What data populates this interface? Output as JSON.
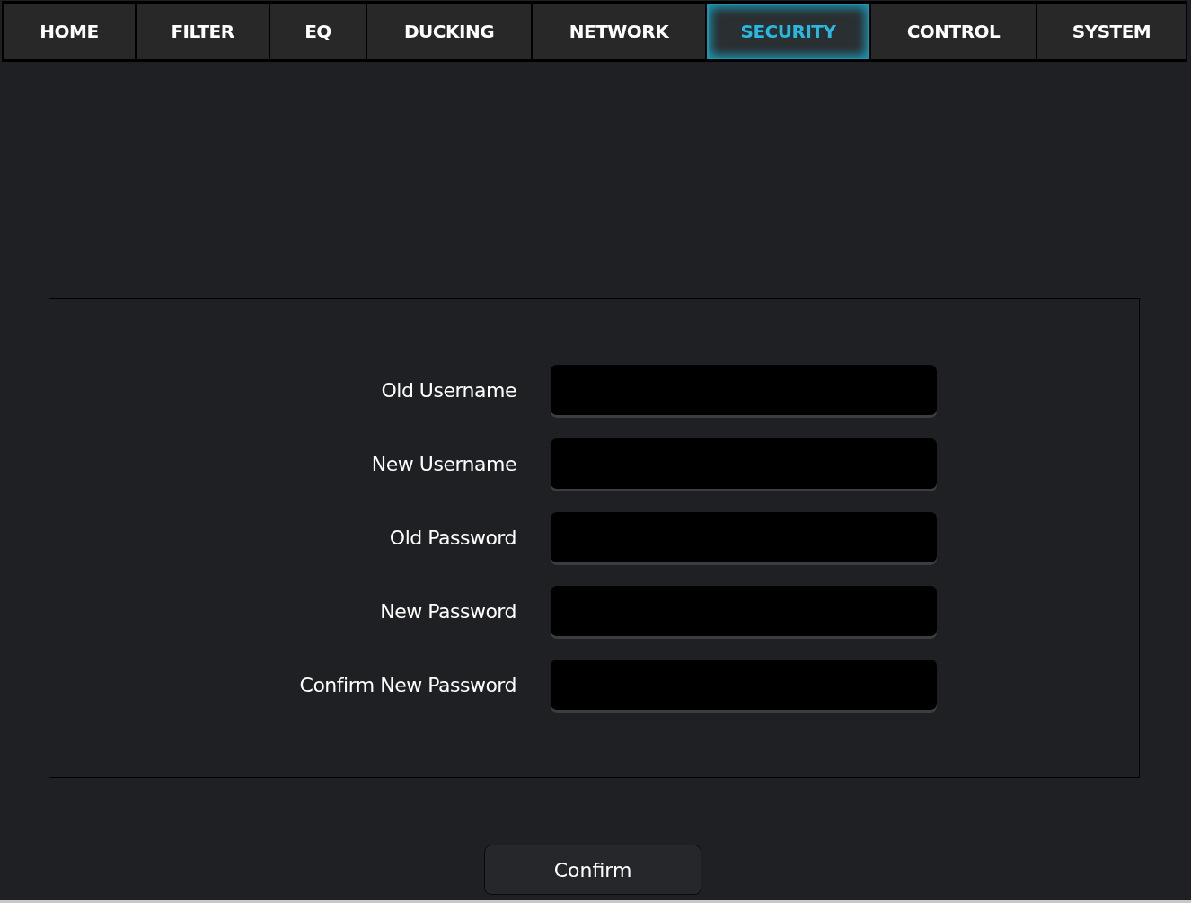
{
  "tabs": [
    {
      "label": "HOME",
      "selected": false
    },
    {
      "label": "FILTER",
      "selected": false
    },
    {
      "label": "EQ",
      "selected": false
    },
    {
      "label": "DUCKING",
      "selected": false
    },
    {
      "label": "NETWORK",
      "selected": false
    },
    {
      "label": "SECURITY",
      "selected": true
    },
    {
      "label": "CONTROL",
      "selected": false
    },
    {
      "label": "SYSTEM",
      "selected": false
    }
  ],
  "form": {
    "fields": [
      {
        "label": "Old Username"
      },
      {
        "label": "New Username"
      },
      {
        "label": "Old Password"
      },
      {
        "label": "New Password"
      },
      {
        "label": "Confirm New Password"
      }
    ]
  },
  "buttons": [
    "Confirm"
  ]
}
